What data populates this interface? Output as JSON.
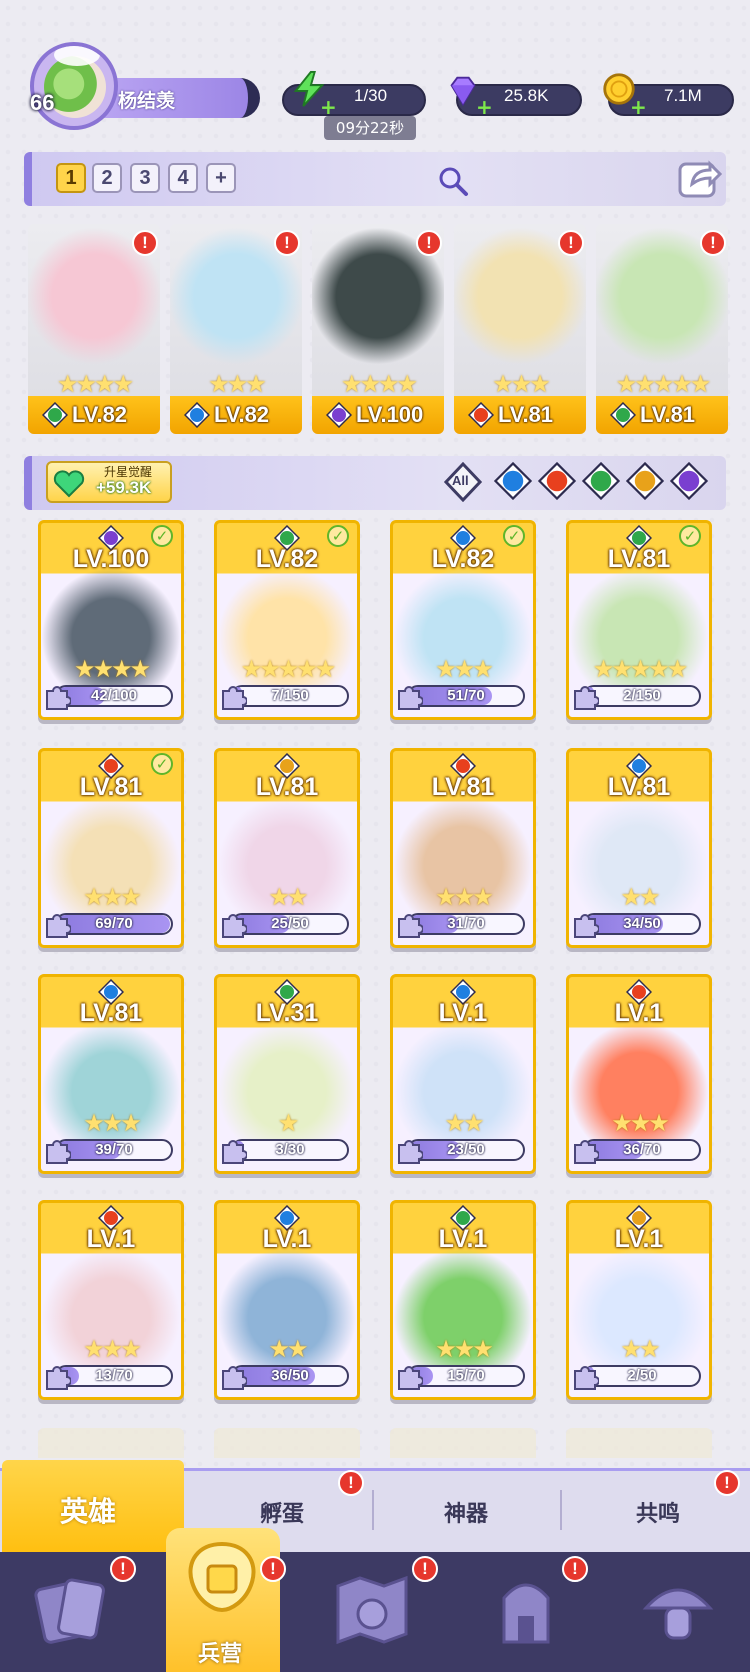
{
  "player": {
    "level": "66",
    "name": "杨结羡"
  },
  "resources": {
    "energy": "1/30",
    "energy_timer": "09分22秒",
    "gems": "25.8K",
    "coins": "7.1M"
  },
  "team_tabs": [
    "1",
    "2",
    "3",
    "4",
    "+"
  ],
  "team_slots": [
    {
      "level": "LV.82",
      "element": "wind",
      "stars": "★★★★",
      "alert": "!"
    },
    {
      "level": "LV.82",
      "element": "water",
      "stars": "★★★",
      "alert": "!"
    },
    {
      "level": "LV.100",
      "element": "dark",
      "stars": "★★★★",
      "alert": "!"
    },
    {
      "level": "LV.81",
      "element": "fire",
      "stars": "★★★",
      "alert": "!"
    },
    {
      "level": "LV.81",
      "element": "wind",
      "stars": "★★★★★",
      "alert": "!"
    }
  ],
  "awaken": {
    "label": "升星觉醒",
    "value": "+59.3K"
  },
  "filters": {
    "all_label": "All",
    "elements": [
      "water",
      "fire",
      "wind",
      "light",
      "dark"
    ]
  },
  "heroes": [
    {
      "level": "LV.100",
      "element": "dark",
      "check": true,
      "stars": "★★★★",
      "frag": "42/100",
      "progress": 0.42
    },
    {
      "level": "LV.82",
      "element": "wind",
      "check": true,
      "stars": "★★★★★",
      "frag": "7/150",
      "progress": 0.05
    },
    {
      "level": "LV.82",
      "element": "water",
      "check": true,
      "stars": "★★★",
      "frag": "51/70",
      "progress": 0.73
    },
    {
      "level": "LV.81",
      "element": "wind",
      "check": true,
      "stars": "★★★★★",
      "frag": "2/150",
      "progress": 0.01
    },
    {
      "level": "LV.81",
      "element": "fire",
      "check": true,
      "stars": "★★★",
      "frag": "69/70",
      "progress": 0.99
    },
    {
      "level": "LV.81",
      "element": "light",
      "check": false,
      "stars": "★★",
      "frag": "25/50",
      "progress": 0.5
    },
    {
      "level": "LV.81",
      "element": "fire",
      "check": false,
      "stars": "★★★",
      "frag": "31/70",
      "progress": 0.44
    },
    {
      "level": "LV.81",
      "element": "water",
      "check": false,
      "stars": "★★",
      "frag": "34/50",
      "progress": 0.68
    },
    {
      "level": "LV.81",
      "element": "water",
      "check": false,
      "stars": "★★★",
      "frag": "39/70",
      "progress": 0.56
    },
    {
      "level": "LV.31",
      "element": "wind",
      "check": false,
      "stars": "★",
      "frag": "3/30",
      "progress": 0.1
    },
    {
      "level": "LV.1",
      "element": "water",
      "check": false,
      "stars": "★★",
      "frag": "23/50",
      "progress": 0.46
    },
    {
      "level": "LV.1",
      "element": "fire",
      "check": false,
      "stars": "★★★",
      "frag": "36/70",
      "progress": 0.51
    },
    {
      "level": "LV.1",
      "element": "fire",
      "check": false,
      "stars": "★★★",
      "frag": "13/70",
      "progress": 0.19
    },
    {
      "level": "LV.1",
      "element": "water",
      "check": false,
      "stars": "★★",
      "frag": "36/50",
      "progress": 0.72
    },
    {
      "level": "LV.1",
      "element": "wind",
      "check": false,
      "stars": "★★★",
      "frag": "15/70",
      "progress": 0.21
    },
    {
      "level": "LV.1",
      "element": "light",
      "check": false,
      "stars": "★★",
      "frag": "2/50",
      "progress": 0.04
    }
  ],
  "subtabs": {
    "heroes": "英雄",
    "hatch": "孵蛋",
    "artifacts": "神器",
    "resonance": "共鸣"
  },
  "nav": {
    "barracks": "兵营"
  },
  "colors": {
    "water": "#1f7fe0",
    "fire": "#e8401e",
    "wind": "#2fa84a",
    "light": "#e8a21a",
    "dark": "#7a3fd0",
    "gold": "#ffc21a",
    "purple": "#8f7fe0"
  }
}
